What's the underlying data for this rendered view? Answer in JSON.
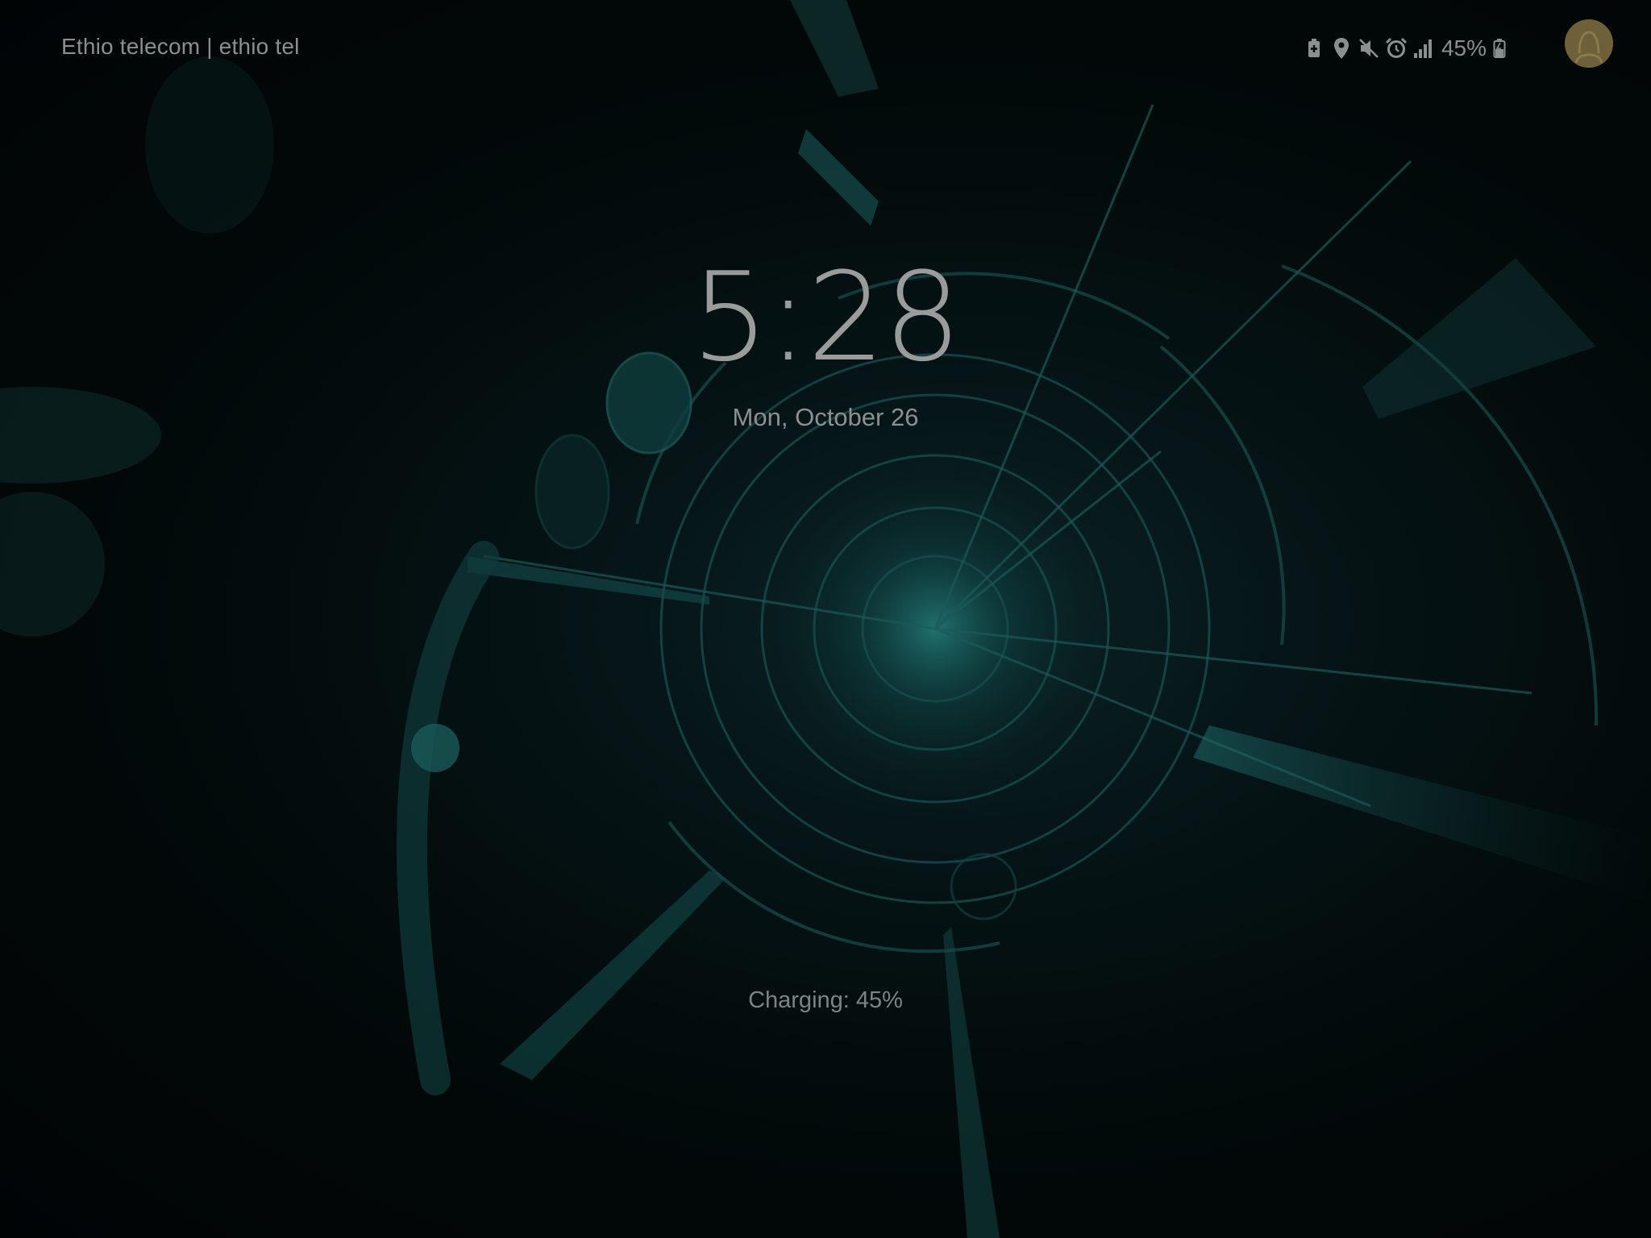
{
  "status_bar": {
    "carrier": "Ethio telecom | ethio tel",
    "icons": [
      "battery-saver-icon",
      "location-icon",
      "mute-icon",
      "alarm-icon",
      "signal-icon"
    ],
    "battery_percent": "45%",
    "battery_icon": "battery-charging-icon"
  },
  "lock_screen": {
    "time": "5:28",
    "date": "Mon, October 26",
    "charging_text": "Charging: 45%"
  },
  "colors": {
    "accent": "#1d6b6a",
    "text": "#8a8f8f",
    "avatar": "#6e6038"
  }
}
